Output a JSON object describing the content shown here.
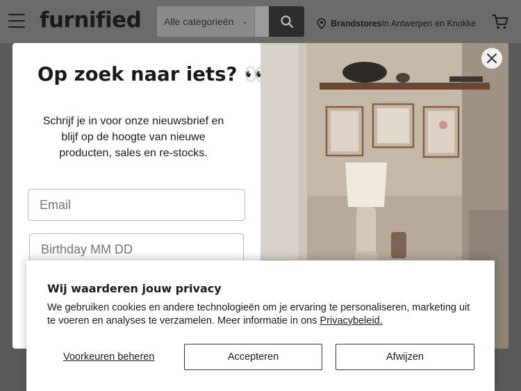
{
  "header": {
    "logo": "furnified",
    "category_select": "Alle categorieën",
    "store_bold": "Brandstores",
    "store_rest": "In Antwerpen en Knokke"
  },
  "popup": {
    "title": "Op zoek naar iets? 👀",
    "text": "Schrijf je in voor onze nieuwsbrief en blijf op de hoogte van nieuwe producten, sales en re-stocks.",
    "email_placeholder": "Email",
    "birthday_placeholder": "Birthday MM DD"
  },
  "cookie": {
    "title": "Wij waarderen jouw privacy",
    "text": "We gebruiken cookies en andere technologieën om je ervaring te personaliseren, marketing uit te voeren en analyses te verzamelen. Meer informatie in ons ",
    "policy_link": "Privacybeleid.",
    "preferences": "Voorkeuren beheren",
    "accept": "Accepteren",
    "reject": "Afwijzen"
  },
  "icons": {
    "menu": "hamburger-icon",
    "search": "search-icon",
    "location": "location-pin-icon",
    "cart": "cart-icon",
    "close": "close-icon"
  }
}
